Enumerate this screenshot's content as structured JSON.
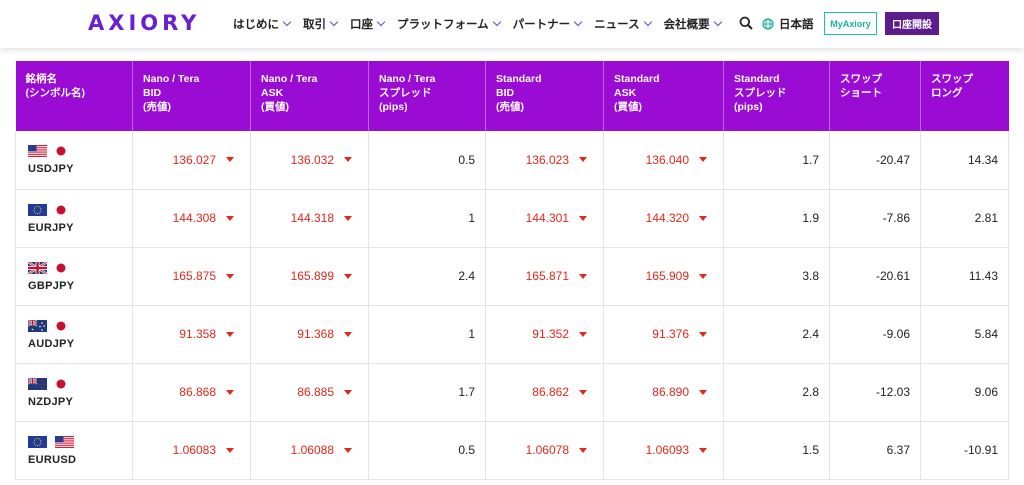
{
  "header": {
    "logo": "AXIORY",
    "nav": [
      "はじめに",
      "取引",
      "口座",
      "プラットフォーム",
      "パートナー",
      "ニュース",
      "会社概要"
    ],
    "language": "日本語",
    "myaxiory_label": "MyAxiory",
    "open_account_label": "口座開設"
  },
  "table": {
    "columns": [
      [
        "銘柄名",
        "(シンボル名)"
      ],
      [
        "Nano / Tera",
        "BID",
        "(売値)"
      ],
      [
        "Nano / Tera",
        "ASK",
        "(買値)"
      ],
      [
        "Nano / Tera",
        "スプレッド",
        "(pips)"
      ],
      [
        "Standard",
        "BID",
        "(売値)"
      ],
      [
        "Standard",
        "ASK",
        "(買値)"
      ],
      [
        "Standard",
        "スプレッド",
        "(pips)"
      ],
      [
        "スワップ",
        "ショート"
      ],
      [
        "スワップ",
        "ロング"
      ]
    ],
    "rows": [
      {
        "symbol": "USDJPY",
        "flags": [
          "us-flag",
          "jp-flag"
        ],
        "nano_bid": "136.027",
        "nano_ask": "136.032",
        "nano_spread": "0.5",
        "std_bid": "136.023",
        "std_ask": "136.040",
        "std_spread": "1.7",
        "swap_short": "-20.47",
        "swap_long": "14.34"
      },
      {
        "symbol": "EURJPY",
        "flags": [
          "eu-flag",
          "jp-flag"
        ],
        "nano_bid": "144.308",
        "nano_ask": "144.318",
        "nano_spread": "1",
        "std_bid": "144.301",
        "std_ask": "144.320",
        "std_spread": "1.9",
        "swap_short": "-7.86",
        "swap_long": "2.81"
      },
      {
        "symbol": "GBPJPY",
        "flags": [
          "gb-flag",
          "jp-flag"
        ],
        "nano_bid": "165.875",
        "nano_ask": "165.899",
        "nano_spread": "2.4",
        "std_bid": "165.871",
        "std_ask": "165.909",
        "std_spread": "3.8",
        "swap_short": "-20.61",
        "swap_long": "11.43"
      },
      {
        "symbol": "AUDJPY",
        "flags": [
          "au-flag",
          "jp-flag"
        ],
        "nano_bid": "91.358",
        "nano_ask": "91.368",
        "nano_spread": "1",
        "std_bid": "91.352",
        "std_ask": "91.376",
        "std_spread": "2.4",
        "swap_short": "-9.06",
        "swap_long": "5.84"
      },
      {
        "symbol": "NZDJPY",
        "flags": [
          "nz-flag",
          "jp-flag"
        ],
        "nano_bid": "86.868",
        "nano_ask": "86.885",
        "nano_spread": "1.7",
        "std_bid": "86.862",
        "std_ask": "86.890",
        "std_spread": "2.8",
        "swap_short": "-12.03",
        "swap_long": "9.06"
      },
      {
        "symbol": "EURUSD",
        "flags": [
          "eu-flag",
          "us-flag"
        ],
        "nano_bid": "1.06083",
        "nano_ask": "1.06088",
        "nano_spread": "0.5",
        "std_bid": "1.06078",
        "std_ask": "1.06093",
        "std_spread": "1.5",
        "swap_short": "6.37",
        "swap_long": "-10.91"
      }
    ]
  },
  "colors": {
    "header_purple": "#9a0bd4",
    "price_down_red": "#e0281e",
    "button_purple": "#5c1c8c",
    "myaxiory_teal": "#19c3b0"
  }
}
